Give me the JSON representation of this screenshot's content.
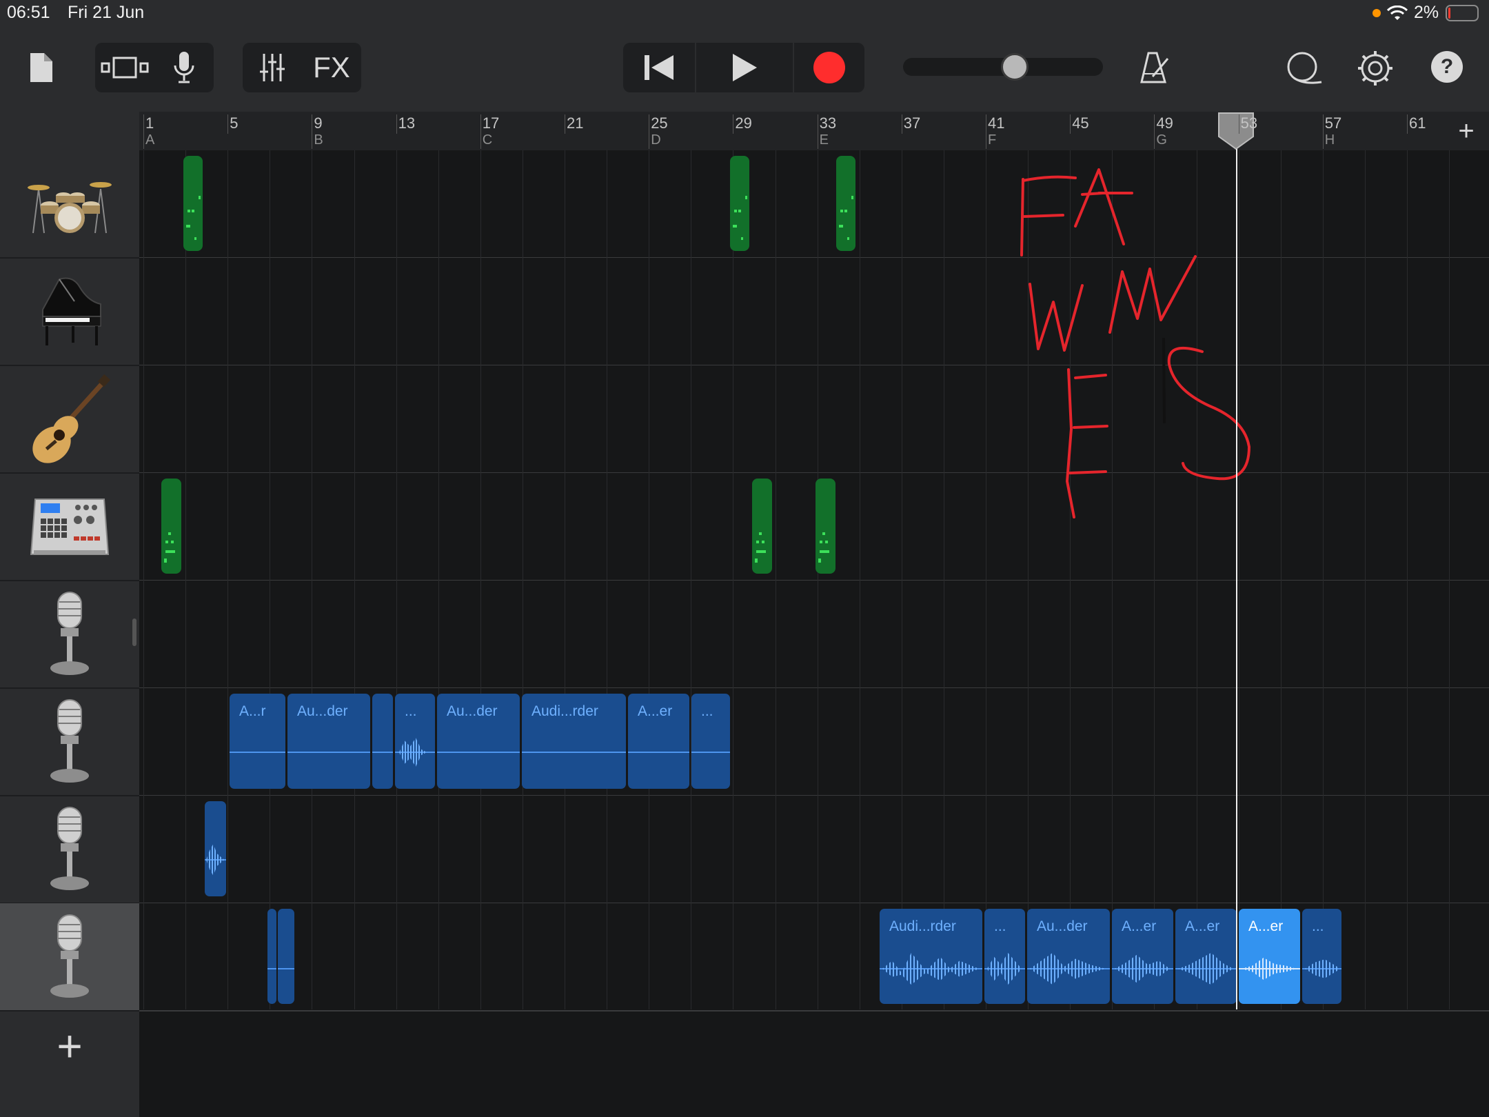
{
  "status": {
    "time": "06:51",
    "date": "Fri 21 Jun",
    "battery": "2%"
  },
  "toolbar": {
    "fx_label": "FX",
    "help_label": "?",
    "record_color": "#ff2d2d"
  },
  "ruler": {
    "bars": [
      "1",
      "5",
      "9",
      "13",
      "17",
      "21",
      "25",
      "29",
      "33",
      "37",
      "41",
      "45",
      "49",
      "53",
      "57",
      "61"
    ],
    "sections": [
      "A",
      "",
      "B",
      "",
      "C",
      "",
      "D",
      "",
      "E",
      "",
      "F",
      "",
      "G",
      "",
      "H",
      ""
    ],
    "add_label": "+"
  },
  "tracks": [
    {
      "name": "drums-track",
      "icon": "drum-kit-icon"
    },
    {
      "name": "piano-track",
      "icon": "grand-piano-icon"
    },
    {
      "name": "guitar-track",
      "icon": "acoustic-guitar-icon"
    },
    {
      "name": "beat-sequencer-track",
      "icon": "drum-machine-icon"
    },
    {
      "name": "audio-recorder-track-1",
      "icon": "microphone-icon"
    },
    {
      "name": "audio-recorder-track-2",
      "icon": "microphone-icon"
    },
    {
      "name": "audio-recorder-track-3",
      "icon": "microphone-icon"
    },
    {
      "name": "audio-recorder-track-4",
      "icon": "microphone-icon"
    }
  ],
  "regions": {
    "track6": [
      "A...r",
      "Au...der",
      "",
      "...",
      "Au...der",
      "Audi...rder",
      "A...er",
      "..."
    ],
    "track8": [
      "",
      "",
      "Audi...rder",
      "...",
      "Au...der",
      "A...er",
      "A...er",
      "A...er",
      "..."
    ]
  },
  "add_track_label": "+",
  "handwriting": "FA WW ES"
}
